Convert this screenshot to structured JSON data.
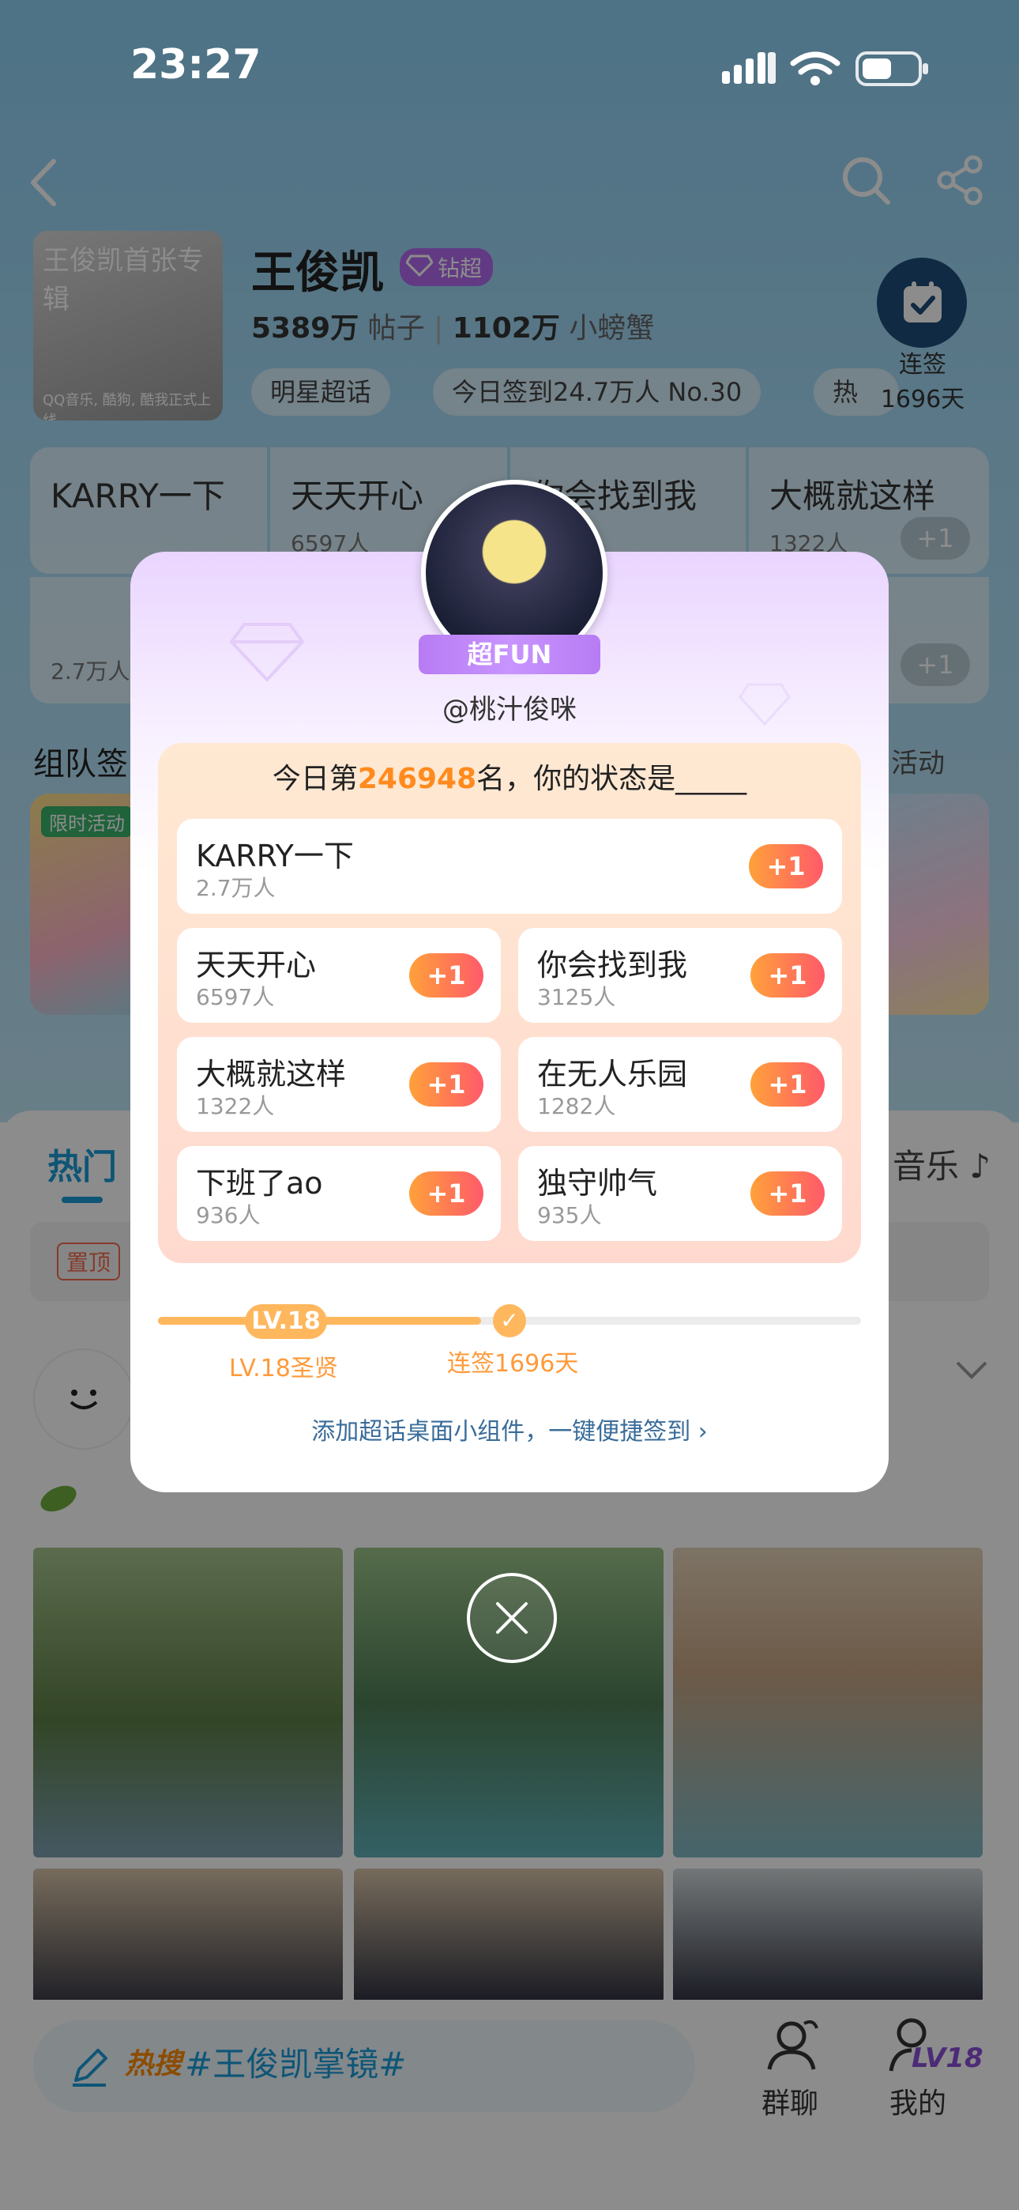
{
  "status_bar": {
    "time": "23:27"
  },
  "header": {
    "cover": {
      "line1": "王俊凯首张专辑",
      "line2": "QQ音乐, 酷狗, 酷我正式上线"
    },
    "artist": "王俊凯",
    "badge": "钻超",
    "posts_count": "5389万",
    "posts_label": "帖子",
    "fans_count": "1102万",
    "fans_label": "小螃蟹",
    "chips": [
      "明星超话",
      "今日签到24.7万人 No.30",
      "热"
    ],
    "signin": {
      "label": "连签",
      "days": "1696天"
    }
  },
  "hot_cards": [
    {
      "name": "KARRY一下",
      "count": "2.7万人"
    },
    {
      "name": "天天开心",
      "count": "6597人"
    },
    {
      "name": "你会找到我",
      "count": ""
    },
    {
      "name": "大概就这样",
      "count": "1322人"
    }
  ],
  "team_section": {
    "title": "组队签",
    "more": "活动"
  },
  "activity_tag": "限时活动",
  "tabs": {
    "hot": "热门",
    "music": "音乐"
  },
  "pin_tag": "置顶",
  "bottom": {
    "search_hot_tag": "热搜",
    "search_text": "#王俊凯掌镜#",
    "chat_label": "群聊",
    "me_label": "我的",
    "me_badge": "LV18"
  },
  "modal": {
    "badge": "超FUN",
    "handle": "@桃汁俊咪",
    "question_prefix": "今日第",
    "rank": "246948",
    "question_suffix": "名，你的状态是_____",
    "plus_label": "+1",
    "options": [
      {
        "name": "KARRY一下",
        "count": "2.7万人"
      },
      {
        "name": "天天开心",
        "count": "6597人"
      },
      {
        "name": "你会找到我",
        "count": "3125人"
      },
      {
        "name": "大概就这样",
        "count": "1322人"
      },
      {
        "name": "在无人乐园",
        "count": "1282人"
      },
      {
        "name": "下班了ao",
        "count": "936人"
      },
      {
        "name": "独守帅气",
        "count": "935人"
      }
    ],
    "level": {
      "pill": "LV.18",
      "pill_label": "LV.18圣贤",
      "streak_label": "连签1696天",
      "progress": 0.46
    },
    "widget_link": "添加超话桌面小组件，一键便捷签到"
  },
  "colors": {
    "accent": "#1a9cd8",
    "plus_gradient_start": "#ffa13a",
    "plus_gradient_end": "#ff5a6a",
    "rank": "#ff8a1d",
    "level": "#ffb75e",
    "fun_purple": "#b77bf3"
  },
  "icons": [
    "back-icon",
    "search-icon",
    "share-icon",
    "calendar-check-icon",
    "diamond-icon",
    "close-icon",
    "pencil-icon",
    "group-chat-icon",
    "profile-icon",
    "music-note-icon",
    "chevron-down-icon",
    "chevron-right-icon",
    "signal-icon",
    "wifi-icon",
    "battery-icon"
  ]
}
